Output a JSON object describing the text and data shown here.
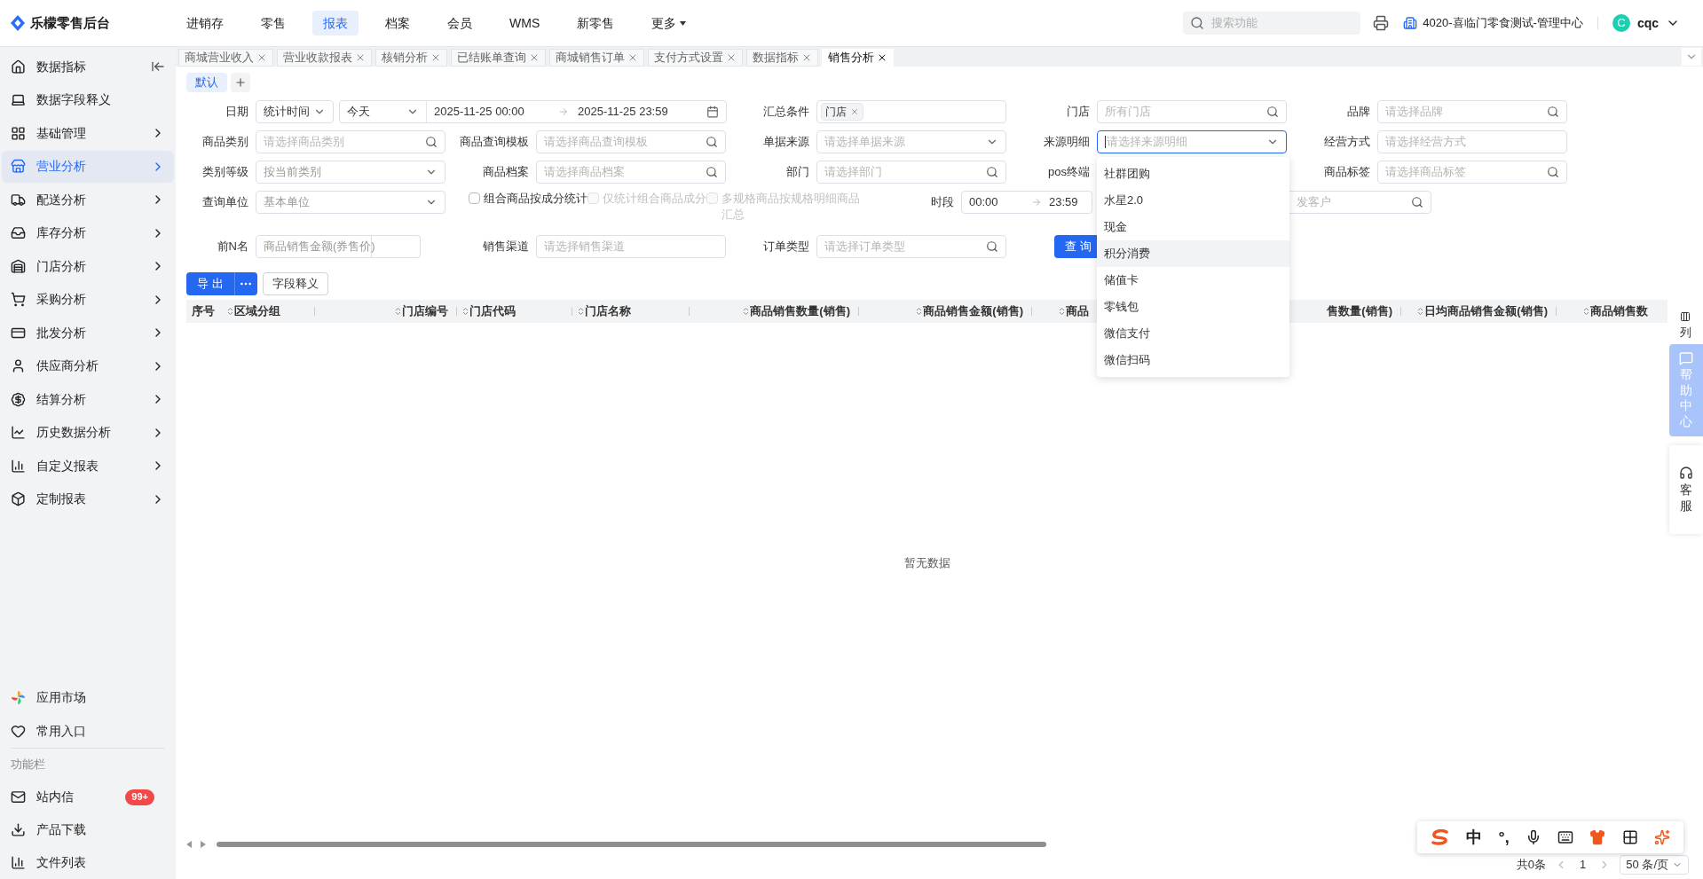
{
  "brand": {
    "name": "乐檬零售后台"
  },
  "top_nav": [
    {
      "label": "进销存",
      "selected": false,
      "dropdown": false
    },
    {
      "label": "零售",
      "selected": false,
      "dropdown": false
    },
    {
      "label": "报表",
      "selected": true,
      "dropdown": false
    },
    {
      "label": "档案",
      "selected": false,
      "dropdown": false
    },
    {
      "label": "会员",
      "selected": false,
      "dropdown": false
    },
    {
      "label": "WMS",
      "selected": false,
      "dropdown": false
    },
    {
      "label": "新零售",
      "selected": false,
      "dropdown": false
    },
    {
      "label": "更多",
      "selected": false,
      "dropdown": true
    }
  ],
  "search": {
    "placeholder": "搜索功能"
  },
  "org": {
    "name": "4020-喜临门零食测试-管理中心"
  },
  "user": {
    "initial": "C",
    "name": "cqc"
  },
  "sidebar": {
    "items": [
      {
        "label": "数据指标",
        "selected": false,
        "chevron": false
      },
      {
        "label": "数据字段释义",
        "selected": false,
        "chevron": false
      },
      {
        "label": "基础管理",
        "selected": false,
        "chevron": true
      },
      {
        "label": "营业分析",
        "selected": true,
        "chevron": true
      },
      {
        "label": "配送分析",
        "selected": false,
        "chevron": true
      },
      {
        "label": "库存分析",
        "selected": false,
        "chevron": true
      },
      {
        "label": "门店分析",
        "selected": false,
        "chevron": true
      },
      {
        "label": "采购分析",
        "selected": false,
        "chevron": true
      },
      {
        "label": "批发分析",
        "selected": false,
        "chevron": true
      },
      {
        "label": "供应商分析",
        "selected": false,
        "chevron": true
      },
      {
        "label": "结算分析",
        "selected": false,
        "chevron": true
      },
      {
        "label": "历史数据分析",
        "selected": false,
        "chevron": true
      },
      {
        "label": "自定义报表",
        "selected": false,
        "chevron": true
      },
      {
        "label": "定制报表",
        "selected": false,
        "chevron": true
      }
    ],
    "bottom_items": [
      {
        "label": "应用市场"
      },
      {
        "label": "常用入口"
      }
    ],
    "section_title": "功能栏",
    "tools": [
      {
        "label": "站内信",
        "badge": "99+"
      },
      {
        "label": "产品下载"
      },
      {
        "label": "文件列表"
      }
    ]
  },
  "page_tabs": [
    {
      "label": "商城营业收入",
      "selected": false
    },
    {
      "label": "营业收款报表",
      "selected": false
    },
    {
      "label": "核销分析",
      "selected": false
    },
    {
      "label": "已结账单查询",
      "selected": false
    },
    {
      "label": "商城销售订单",
      "selected": false
    },
    {
      "label": "支付方式设置",
      "selected": false
    },
    {
      "label": "数据指标",
      "selected": false
    },
    {
      "label": "销售分析",
      "selected": true
    }
  ],
  "views": [
    {
      "label": "默认",
      "selected": true
    }
  ],
  "filter_rows": [
    [
      {
        "kind": "date",
        "label": "日期",
        "type": "统计时间",
        "range": "今天",
        "start": "2025-11-25 00:00",
        "end": "2025-11-25 23:59"
      },
      {
        "kind": "tags",
        "label": "汇总条件",
        "tags": [
          "门店"
        ]
      },
      {
        "kind": "search",
        "label": "门店",
        "placeholder": "所有门店"
      },
      {
        "kind": "search",
        "label": "品牌",
        "placeholder": "请选择品牌"
      }
    ],
    [
      {
        "kind": "search",
        "label": "商品类别",
        "placeholder": "请选择商品类别"
      },
      {
        "kind": "search",
        "label": "商品查询模板",
        "placeholder": "请选择商品查询模板"
      },
      {
        "kind": "select",
        "label": "单据来源",
        "placeholder": "请选择单据来源"
      },
      {
        "kind": "select",
        "label": "来源明细",
        "placeholder": "请选择来源明细",
        "focused": true,
        "options": [
          {
            "label": "社群团购",
            "hovered": false
          },
          {
            "label": "水星2.0",
            "hovered": false
          },
          {
            "label": "现金",
            "hovered": false
          },
          {
            "label": "积分消费",
            "hovered": true
          },
          {
            "label": "储值卡",
            "hovered": false
          },
          {
            "label": "零钱包",
            "hovered": false
          },
          {
            "label": "微信支付",
            "hovered": false
          },
          {
            "label": "微信扫码",
            "hovered": false
          }
        ]
      },
      {
        "kind": "text",
        "label": "经营方式",
        "placeholder": "请选择经营方式"
      }
    ],
    [
      {
        "kind": "select",
        "label": "类别等级",
        "placeholder": "按当前类别"
      },
      {
        "kind": "search",
        "label": "商品档案",
        "placeholder": "请选择商品档案"
      },
      {
        "kind": "search",
        "label": "部门",
        "placeholder": "请选择部门"
      },
      {
        "kind": "covered",
        "label": "pos终端"
      },
      {
        "kind": "search",
        "label": "商品标签",
        "placeholder": "请选择商品标签"
      }
    ]
  ],
  "options_row": {
    "unit": {
      "label": "查询单位",
      "value": "基本单位"
    },
    "checkboxes": [
      {
        "label": "组合商品按成分统计",
        "checked": false,
        "disabled": false
      },
      {
        "label": "仅统计组合商品成分",
        "checked": false,
        "disabled": true
      },
      {
        "label": "多规格商品按规格明细商品汇总",
        "checked": false,
        "disabled": true
      }
    ],
    "time": {
      "label": "时段",
      "start": "00:00",
      "end": "23:59"
    },
    "customer": {
      "placeholder": "发客户"
    }
  },
  "top_n_row": {
    "top_n": {
      "label": "前N名",
      "value": "商品销售金额(券售价)"
    },
    "fields": [
      {
        "kind": "text",
        "label": "销售渠道",
        "placeholder": "请选择销售渠道"
      },
      {
        "kind": "search",
        "label": "订单类型",
        "placeholder": "请选择订单类型"
      }
    ],
    "query_button": "查 询"
  },
  "actions": {
    "export": "导 出",
    "field_help": "字段释义"
  },
  "table": {
    "columns": [
      {
        "label": "序号",
        "sortable": false
      },
      {
        "label": "区域分组",
        "sortable": true
      },
      {
        "label": "门店编号",
        "sortable": true
      },
      {
        "label": "门店代码",
        "sortable": true
      },
      {
        "label": "门店名称",
        "sortable": true
      },
      {
        "label": "商品销售数量(销售)",
        "sortable": true
      },
      {
        "label": "商品销售金额(销售)",
        "sortable": true
      },
      {
        "label": "商品",
        "sortable": true
      },
      {
        "label": "售数量(销售)",
        "sortable": false
      },
      {
        "label": "日均商品销售金额(销售)",
        "sortable": true
      },
      {
        "label": "商品销售数",
        "sortable": true
      }
    ],
    "empty_text": "暂无数据"
  },
  "column_settings": "列",
  "help_tab": "帮助中心",
  "service_tab": "客服",
  "pagination": {
    "total": "共0条",
    "page": "1",
    "page_size": "50 条/页"
  },
  "ime": {
    "items": [
      "中",
      "°,"
    ]
  }
}
